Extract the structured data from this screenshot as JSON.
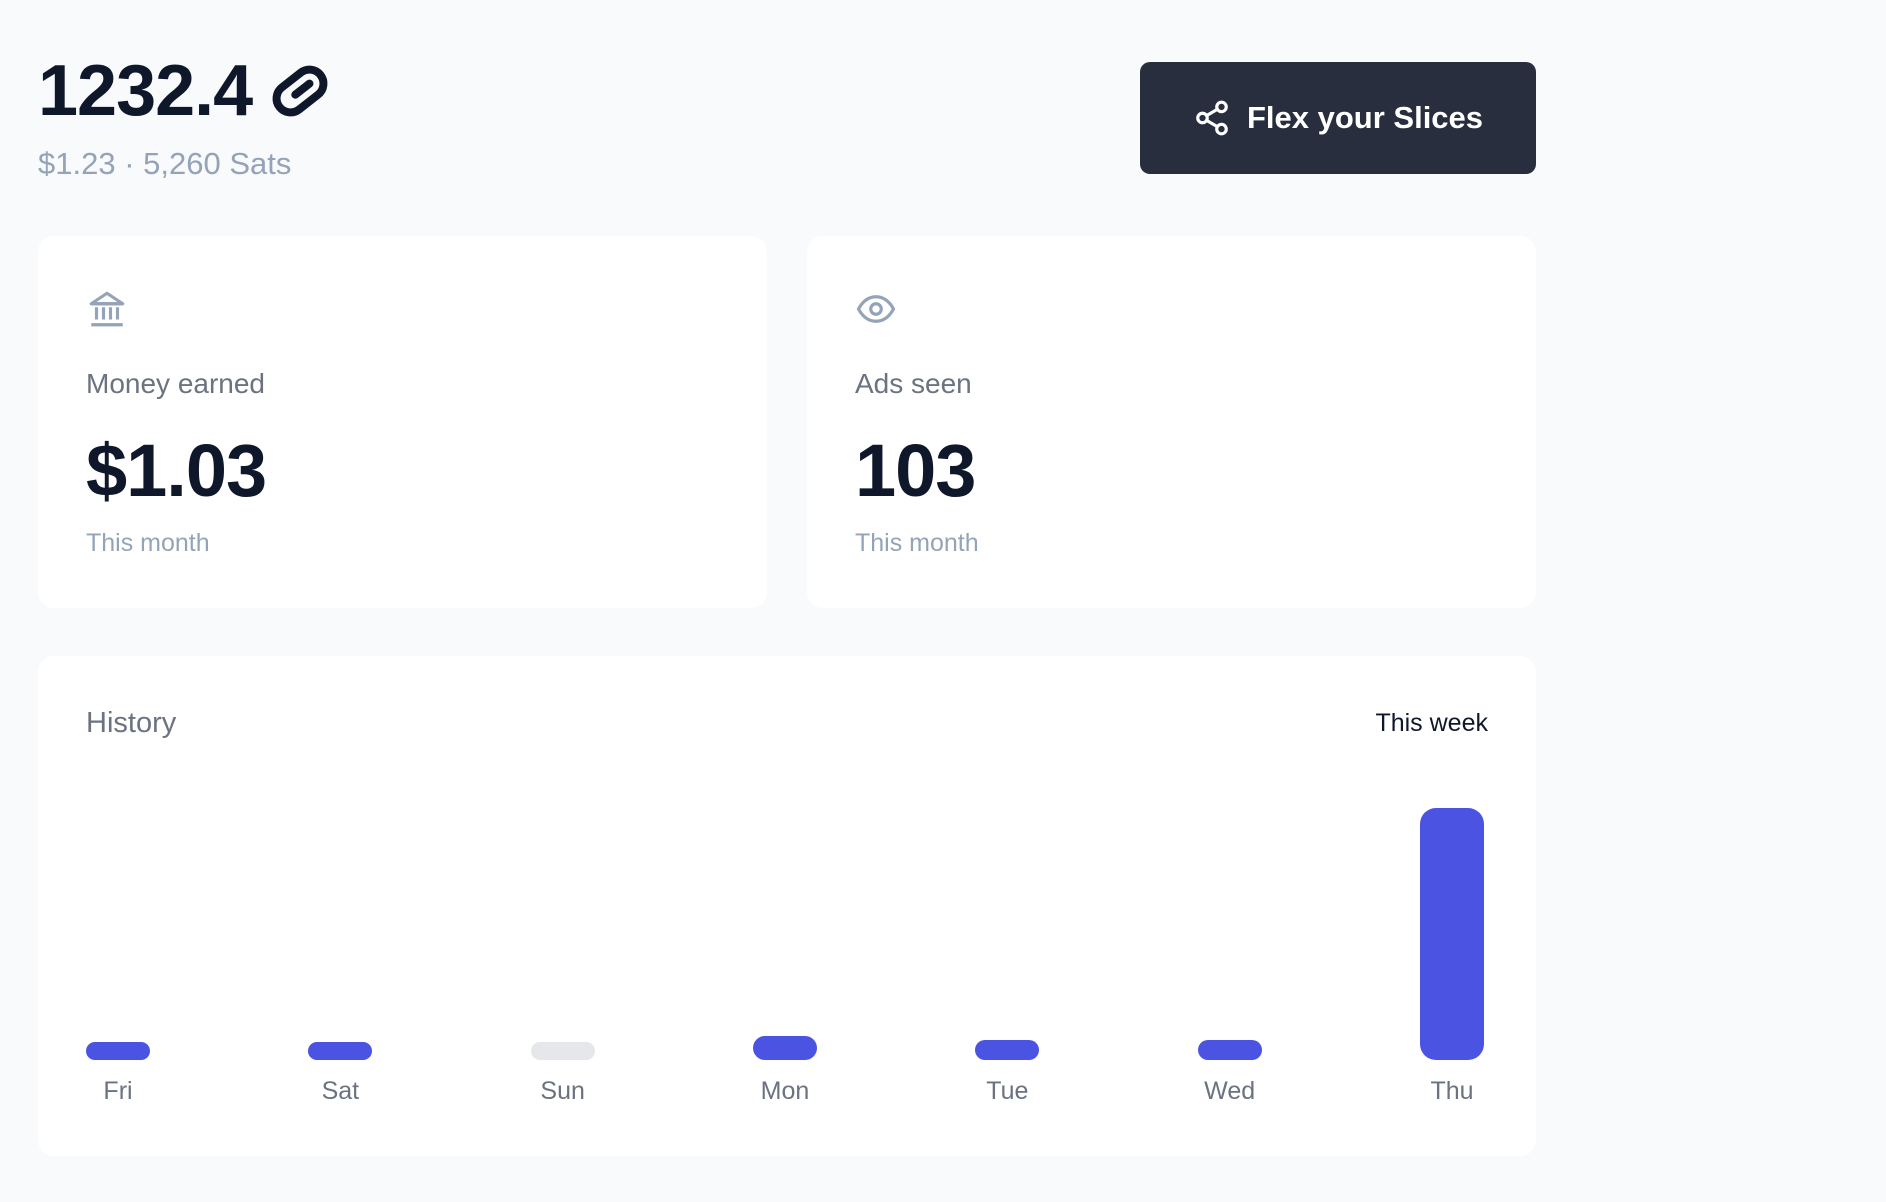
{
  "header": {
    "balance": "1232.4",
    "balance_icon": "slice-logo-icon",
    "subtitle": "$1.23 · 5,260 Sats",
    "share_button": {
      "label": "Flex your Slices",
      "icon": "share-icon"
    }
  },
  "stats": {
    "money": {
      "icon": "bank-icon",
      "label": "Money earned",
      "value": "$1.03",
      "period": "This month"
    },
    "ads": {
      "icon": "eye-icon",
      "label": "Ads seen",
      "value": "103",
      "period": "This month"
    }
  },
  "history": {
    "title": "History",
    "range": "This week",
    "colors": {
      "active": "#4b53e3",
      "empty": "#e5e7eb"
    },
    "chart_data": {
      "type": "bar",
      "categories": [
        "Fri",
        "Sat",
        "Sun",
        "Mon",
        "Tue",
        "Wed",
        "Thu"
      ],
      "values": [
        2,
        2,
        0,
        3,
        2.5,
        2.5,
        31
      ],
      "ylim": [
        0,
        31
      ],
      "grid": false
    }
  }
}
